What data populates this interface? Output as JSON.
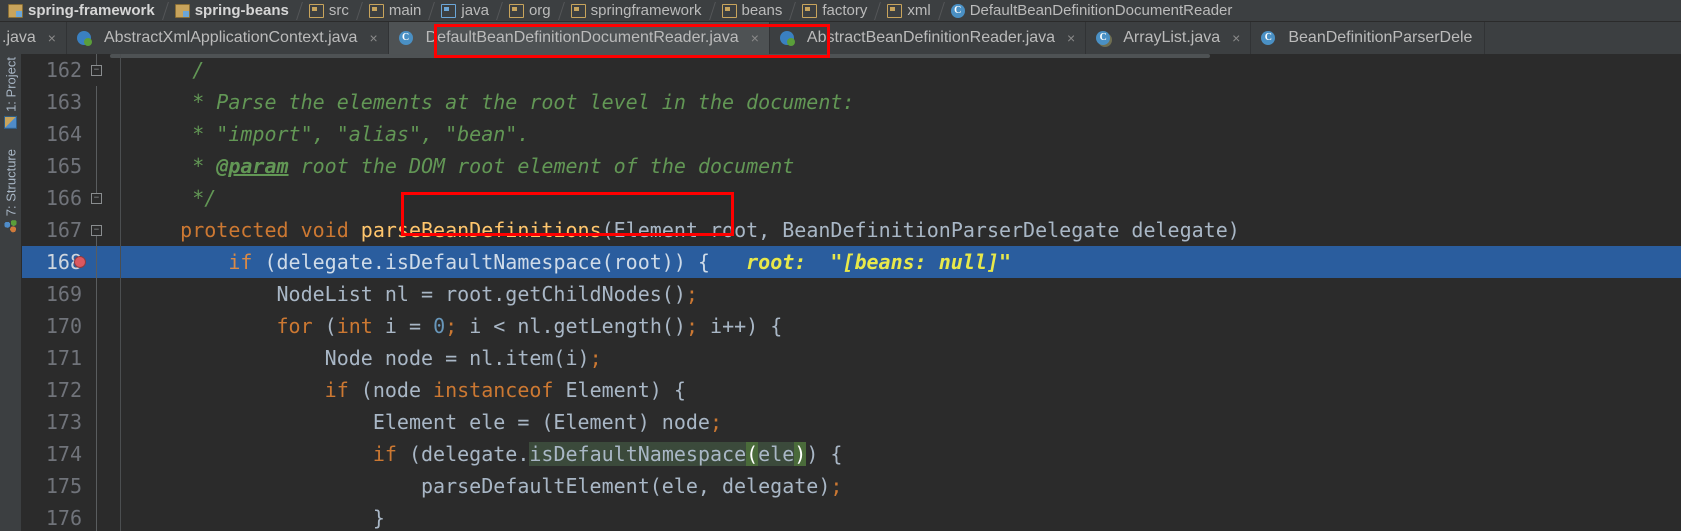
{
  "breadcrumb": {
    "items": [
      {
        "label": "spring-framework",
        "icon": "module-icon",
        "bold": true
      },
      {
        "label": "spring-beans",
        "icon": "module-icon",
        "bold": true
      },
      {
        "label": "src",
        "icon": "folder-icon",
        "bold": false
      },
      {
        "label": "main",
        "icon": "folder-icon",
        "bold": false
      },
      {
        "label": "java",
        "icon": "source-folder-icon",
        "bold": false
      },
      {
        "label": "org",
        "icon": "folder-icon",
        "bold": false
      },
      {
        "label": "springframework",
        "icon": "folder-icon",
        "bold": false
      },
      {
        "label": "beans",
        "icon": "folder-icon",
        "bold": false
      },
      {
        "label": "factory",
        "icon": "folder-icon",
        "bold": false
      },
      {
        "label": "xml",
        "icon": "folder-icon",
        "bold": false
      },
      {
        "label": "DefaultBeanDefinitionDocumentReader",
        "icon": "class-icon",
        "bold": false
      }
    ]
  },
  "tabs": {
    "items": [
      {
        "label": ".java",
        "icon": "class-icon-green",
        "active": false,
        "truncated": true,
        "close": "×"
      },
      {
        "label": "AbstractXmlApplicationContext.java",
        "icon": "class-icon-green",
        "active": false,
        "close": "×"
      },
      {
        "label": "DefaultBeanDefinitionDocumentReader.java",
        "icon": "class-icon",
        "active": true,
        "close": "×"
      },
      {
        "label": "AbstractBeanDefinitionReader.java",
        "icon": "class-icon-green",
        "active": false,
        "close": "×"
      },
      {
        "label": "ArrayList.java",
        "icon": "class-icon-lib",
        "active": false,
        "close": "×"
      },
      {
        "label": "BeanDefinitionParserDele",
        "icon": "class-icon",
        "active": false,
        "close": ""
      }
    ]
  },
  "tool_windows": {
    "items": [
      {
        "label": "1: Project",
        "icon": "project-icon"
      },
      {
        "label": "7: Structure",
        "icon": "structure-icon"
      }
    ]
  },
  "editor": {
    "lines": [
      {
        "number": "162",
        "fold": "end",
        "tokens": [
          {
            "text": "     ",
            "cls": "t-plain"
          },
          {
            "text": "/",
            "cls": "t-cmt"
          }
        ]
      },
      {
        "number": "163",
        "fold": "bar",
        "tokens": [
          {
            "text": "     * Parse the elements at the root level in the document:",
            "cls": "t-cmt"
          }
        ]
      },
      {
        "number": "164",
        "fold": "bar",
        "tokens": [
          {
            "text": "     * \"import\", \"alias\", \"bean\".",
            "cls": "t-cmt"
          }
        ]
      },
      {
        "number": "165",
        "fold": "bar",
        "tokens": [
          {
            "text": "     * ",
            "cls": "t-cmt"
          },
          {
            "text": "@param",
            "cls": "t-cmt-tag"
          },
          {
            "text": " root the DOM root element of the document",
            "cls": "t-cmt"
          }
        ]
      },
      {
        "number": "166",
        "fold": "end",
        "tokens": [
          {
            "text": "     */",
            "cls": "t-cmt"
          }
        ]
      },
      {
        "number": "167",
        "fold": "start",
        "tokens": [
          {
            "text": "    ",
            "cls": "t-plain"
          },
          {
            "text": "protected void ",
            "cls": "t-kw"
          },
          {
            "text": "parseBeanDefinitions",
            "cls": "t-method"
          },
          {
            "text": "(Element root, BeanDefinitionParserDelegate delegate)",
            "cls": "t-plain"
          }
        ]
      },
      {
        "number": "168",
        "fold": "bar",
        "highlight": true,
        "breakpoint": true,
        "tokens": [
          {
            "text": "        ",
            "cls": "t-plain"
          },
          {
            "text": "if ",
            "cls": "t-kw"
          },
          {
            "text": "(delegate.isDefaultNamespace(root)) {",
            "cls": "t-plain"
          },
          {
            "text": "   ",
            "cls": "t-plain"
          },
          {
            "text": "root:  \"[beans: null]\"",
            "cls": "t-debug"
          }
        ]
      },
      {
        "number": "169",
        "fold": "bar",
        "tokens": [
          {
            "text": "            NodeList nl = root.getChildNodes()",
            "cls": "t-plain"
          },
          {
            "text": ";",
            "cls": "t-semi"
          }
        ]
      },
      {
        "number": "170",
        "fold": "bar",
        "tokens": [
          {
            "text": "            ",
            "cls": "t-plain"
          },
          {
            "text": "for ",
            "cls": "t-kw"
          },
          {
            "text": "(",
            "cls": "t-plain"
          },
          {
            "text": "int ",
            "cls": "t-kw"
          },
          {
            "text": "i = ",
            "cls": "t-plain"
          },
          {
            "text": "0",
            "cls": "t-num"
          },
          {
            "text": ";",
            "cls": "t-semi"
          },
          {
            "text": " i < nl.getLength()",
            "cls": "t-plain"
          },
          {
            "text": ";",
            "cls": "t-semi"
          },
          {
            "text": " i++) {",
            "cls": "t-plain"
          }
        ]
      },
      {
        "number": "171",
        "fold": "bar",
        "tokens": [
          {
            "text": "                Node node = nl.item(i)",
            "cls": "t-plain"
          },
          {
            "text": ";",
            "cls": "t-semi"
          }
        ]
      },
      {
        "number": "172",
        "fold": "bar",
        "tokens": [
          {
            "text": "                ",
            "cls": "t-plain"
          },
          {
            "text": "if ",
            "cls": "t-kw"
          },
          {
            "text": "(node ",
            "cls": "t-plain"
          },
          {
            "text": "instanceof ",
            "cls": "t-kw"
          },
          {
            "text": "Element) {",
            "cls": "t-plain"
          }
        ]
      },
      {
        "number": "173",
        "fold": "bar",
        "tokens": [
          {
            "text": "                    Element ele = (Element) node",
            "cls": "t-plain"
          },
          {
            "text": ";",
            "cls": "t-semi"
          }
        ]
      },
      {
        "number": "174",
        "fold": "bar",
        "tokens": [
          {
            "text": "                    ",
            "cls": "t-plain"
          },
          {
            "text": "if ",
            "cls": "t-kw"
          },
          {
            "text": "(delegate.",
            "cls": "t-plain"
          },
          {
            "text": "isDefaultNamespace",
            "cls": "t-plain t-hl-usage"
          },
          {
            "text": "(",
            "cls": "t-brace-match"
          },
          {
            "text": "ele",
            "cls": "t-plain t-hl-usage"
          },
          {
            "text": ")",
            "cls": "t-brace-match"
          },
          {
            "text": ") {",
            "cls": "t-plain"
          }
        ]
      },
      {
        "number": "175",
        "fold": "bar",
        "tokens": [
          {
            "text": "                        parseDefaultElement(ele, delegate)",
            "cls": "t-plain"
          },
          {
            "text": ";",
            "cls": "t-semi"
          }
        ]
      },
      {
        "number": "176",
        "fold": "bar",
        "tokens": [
          {
            "text": "                    }",
            "cls": "t-plain"
          }
        ]
      }
    ]
  },
  "annotations": {
    "items": [
      {
        "name": "tab-highlight-box"
      },
      {
        "name": "method-name-highlight-box"
      }
    ]
  },
  "colors": {
    "annotation": "#ff0000",
    "highlight_line": "#2a5d9e",
    "editor_bg": "#2b2b2b",
    "chrome_bg": "#3c3f41"
  }
}
